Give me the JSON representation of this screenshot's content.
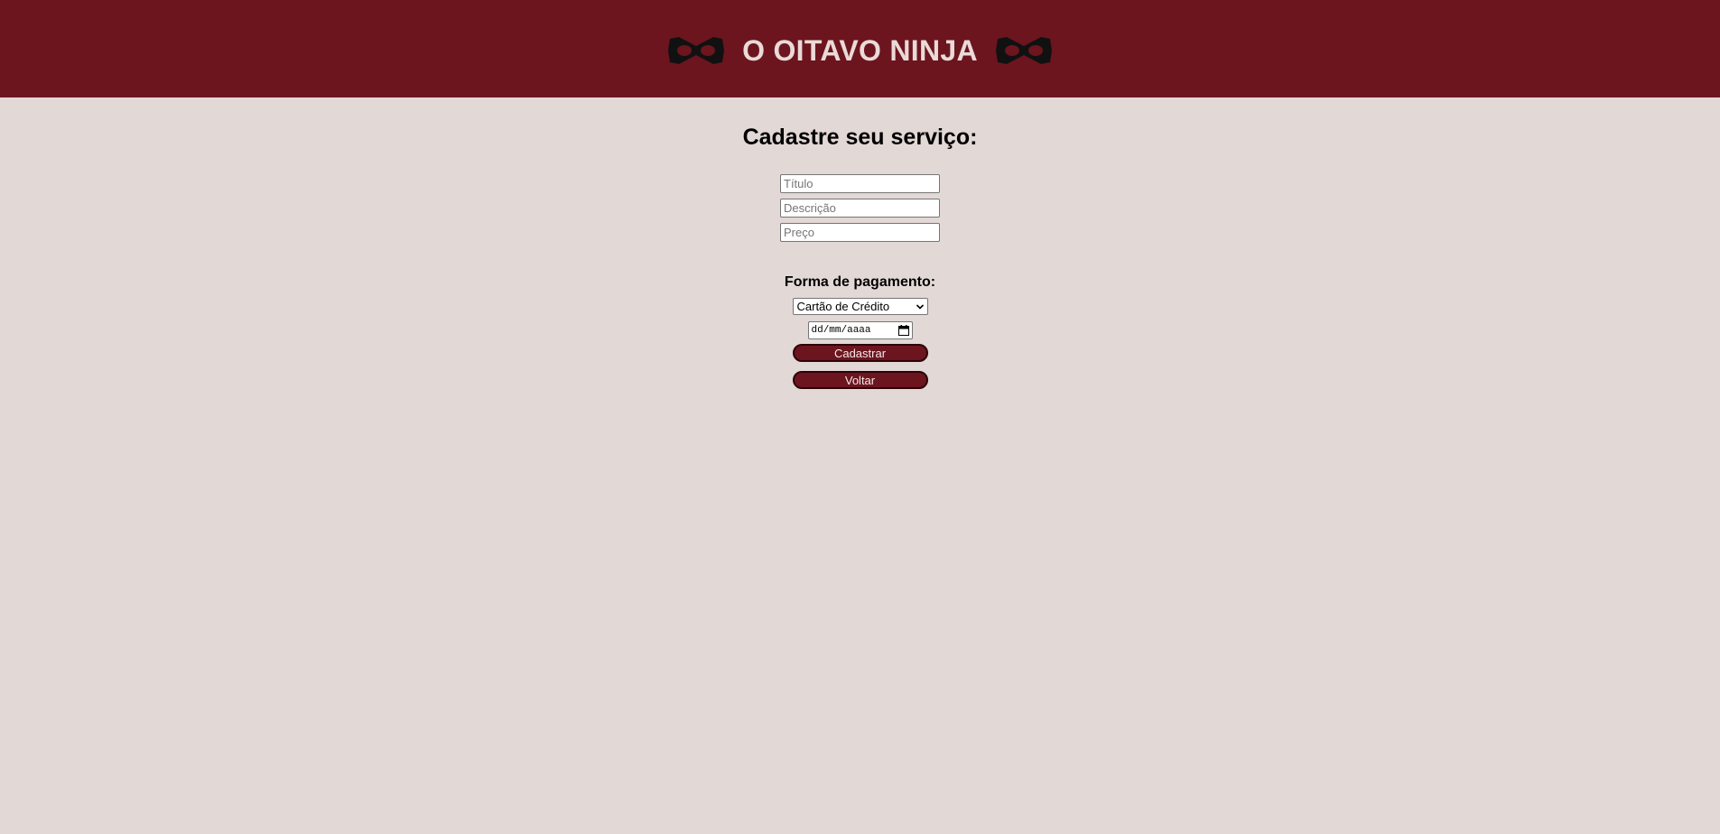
{
  "header": {
    "title": "O OITAVO NINJA",
    "icon_left": "ninja-mask-icon",
    "icon_right": "ninja-mask-icon",
    "background_color": "#6c151f",
    "title_color": "#eadad8"
  },
  "form": {
    "heading": "Cadastre seu serviço:",
    "titulo_placeholder": "Título",
    "descricao_placeholder": "Descrição",
    "preco_placeholder": "Preço",
    "payment_label": "Forma de pagamento:",
    "payment_selected": "Cartão de Crédito",
    "date_placeholder": "dd/mm/aaaa",
    "submit_label": "Cadastrar",
    "back_label": "Voltar"
  },
  "page": {
    "background_color": "#e2d8d6",
    "button_color": "#6c151f"
  }
}
